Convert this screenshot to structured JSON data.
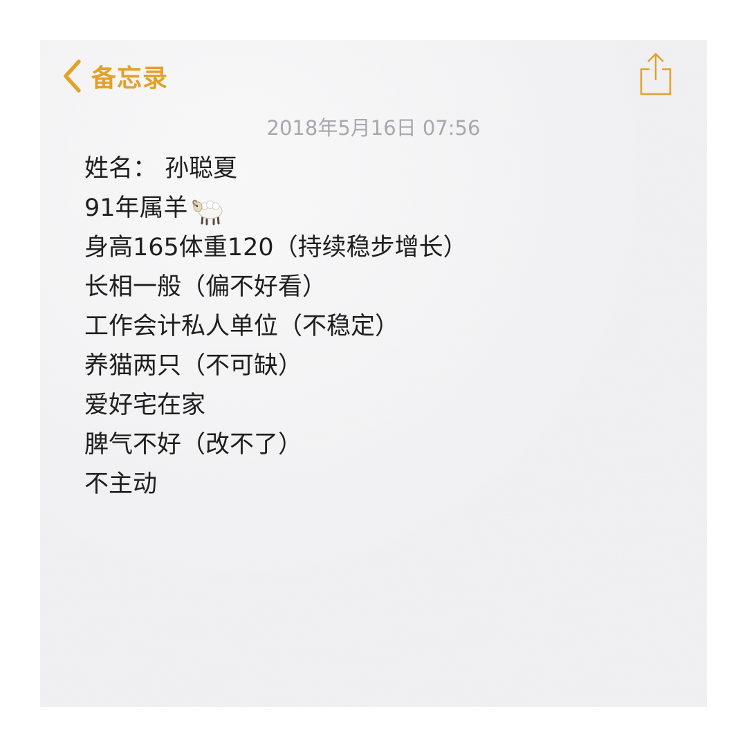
{
  "nav": {
    "back_label": "备忘录",
    "back_icon": "chevron-left-icon",
    "share_icon": "share-icon",
    "accent_color": "#e1a12a"
  },
  "note": {
    "timestamp": "2018年5月16日 07:56",
    "lines": [
      "姓名： 孙聪夏",
      "91年属羊",
      "身高165体重120（持续稳步增长）",
      "长相一般（偏不好看）",
      "工作会计私人单位（不稳定）",
      "养猫两只（不可缺）",
      "爱好宅在家",
      "脾气不好（改不了）",
      "不主动"
    ],
    "emoji_icon": "sheep-emoji-icon"
  }
}
